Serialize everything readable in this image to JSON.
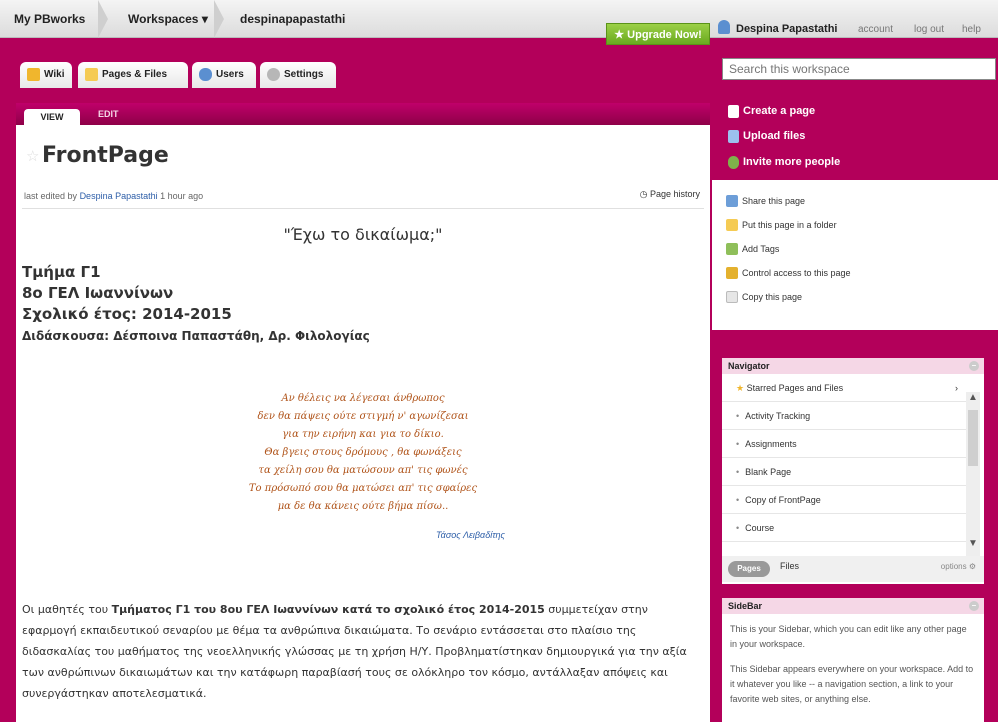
{
  "topbar": {
    "home": "My PBworks",
    "workspaces": "Workspaces",
    "workspace_name": "despinapapastathi",
    "upgrade": "Upgrade Now!",
    "user": "Despina Papastathi",
    "account": "account",
    "logout": "log out",
    "help": "help"
  },
  "tabs": [
    {
      "label": "Wiki"
    },
    {
      "label": "Pages & Files"
    },
    {
      "label": "Users"
    },
    {
      "label": "Settings"
    }
  ],
  "search": {
    "placeholder": "Search this workspace"
  },
  "page": {
    "view_tab": "VIEW",
    "edit_tab": "EDIT",
    "title": "FrontPage",
    "meta_prefix": "last edited by",
    "meta_user": "Despina Papastathi",
    "meta_time": "1 hour ago",
    "history": "Page history",
    "heading": "\"Έχω το δικαίωμα;\"",
    "lines": [
      "Τμήμα Γ1",
      "8ο ΓΕΛ Ιωαννίνων",
      "Σχολικό έτος: 2014-2015"
    ],
    "teacher": "Διδάσκουσα: Δέσποινα Παπαστάθη, Δρ. Φιλολογίας",
    "poem": [
      "Αν θέλεις να λέγεσαι άνθρωπος",
      "δεν θα πάψεις ούτε στιγμή ν' αγωνίζεσαι",
      "για την ειρήνη και για το δίκιο.",
      "Θα βγεις στους δρόμους , θα φωνάξεις",
      "τα χείλη σου θα ματώσουν απ' τις φωνές",
      "Το πρόσωπό σου θα ματώσει απ' τις σφαίρες",
      "μα δε θα κάνεις ούτε βήμα πίσω.."
    ],
    "poet": "Τάσος Λειβαδίτης",
    "paragraph_start": "Οι μαθητές του ",
    "paragraph_bold": "Τμήματος Γ1 του 8ου ΓΕΛ Ιωαννίνων κατά το σχολικό έτος 2014-2015",
    "paragraph_rest": " συμμετείχαν στην εφαρμογή εκπαιδευτικού σεναρίου με θέμα τα ανθρώπινα δικαιώματα. Το σενάριο εντάσσεται στο πλαίσιο της διδασκαλίας του μαθήματος της νεοελληνικής γλώσσας με τη χρήση Η/Υ. Προβληματίστηκαν δημιουργικά για την αξία των ανθρώπινων δικαιωμάτων και την κατάφωρη παραβίασή τους σε ολόκληρο τον κόσμο, αντάλλαξαν απόψεις και συνεργάστηκαν αποτελεσματικά."
  },
  "create": {
    "create_page": "Create a page",
    "upload_files": "Upload files",
    "invite": "Invite more people"
  },
  "actions": [
    "Share this page",
    "Put this page in a folder",
    "Add Tags",
    "Control access to this page",
    "Copy this page"
  ],
  "navigator": {
    "title": "Navigator",
    "starred": "Starred Pages and Files",
    "items": [
      "Activity Tracking",
      "Assignments",
      "Blank Page",
      "Copy of FrontPage",
      "Course"
    ],
    "tab_pages": "Pages",
    "tab_files": "Files",
    "options": "options"
  },
  "sidebar": {
    "title": "SideBar",
    "text1": "This is your Sidebar, which you can edit like any other page in your workspace.",
    "text2": "This Sidebar appears everywhere on your workspace. Add to it whatever you like -- a navigation section, a link to your favorite web sites, or anything else."
  }
}
